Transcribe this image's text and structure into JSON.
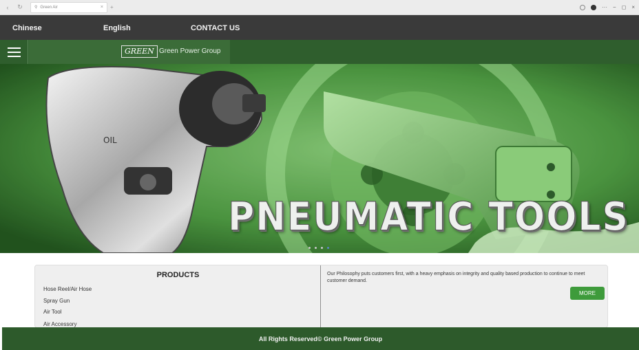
{
  "browser": {
    "tab_title": "Green Air",
    "tab_close": "×",
    "new_tab": "+",
    "window_controls": [
      "···",
      "−",
      "◻",
      "×"
    ]
  },
  "nav": {
    "items": [
      {
        "label": "Chinese"
      },
      {
        "label": "English"
      },
      {
        "label": "CONTACT US"
      }
    ]
  },
  "brand": {
    "logo_text": "GREEN",
    "company_name": "Green Power Group"
  },
  "hero": {
    "title": "PNEUMATIC TOOLS",
    "slide_count": 4,
    "active_slide": 4
  },
  "products": {
    "title": "PRODUCTS",
    "items": [
      {
        "label": "Hose Reel/Air Hose"
      },
      {
        "label": "Spray Gun"
      },
      {
        "label": "Air Tool"
      },
      {
        "label": "Air Accessory"
      }
    ]
  },
  "philosophy": {
    "text": "Our Philosophy puts customers first, with a heavy emphasis on integrity and quality based production to continue to meet customer demand.",
    "more_label": "MORE"
  },
  "footer": {
    "text": "All Rights Reserved© Green Power Group"
  },
  "colors": {
    "nav_bg": "#3a3a3a",
    "brand_green": "#2f5e2d",
    "button_green": "#3e9b3b",
    "footer_green": "#2d5a2b"
  }
}
